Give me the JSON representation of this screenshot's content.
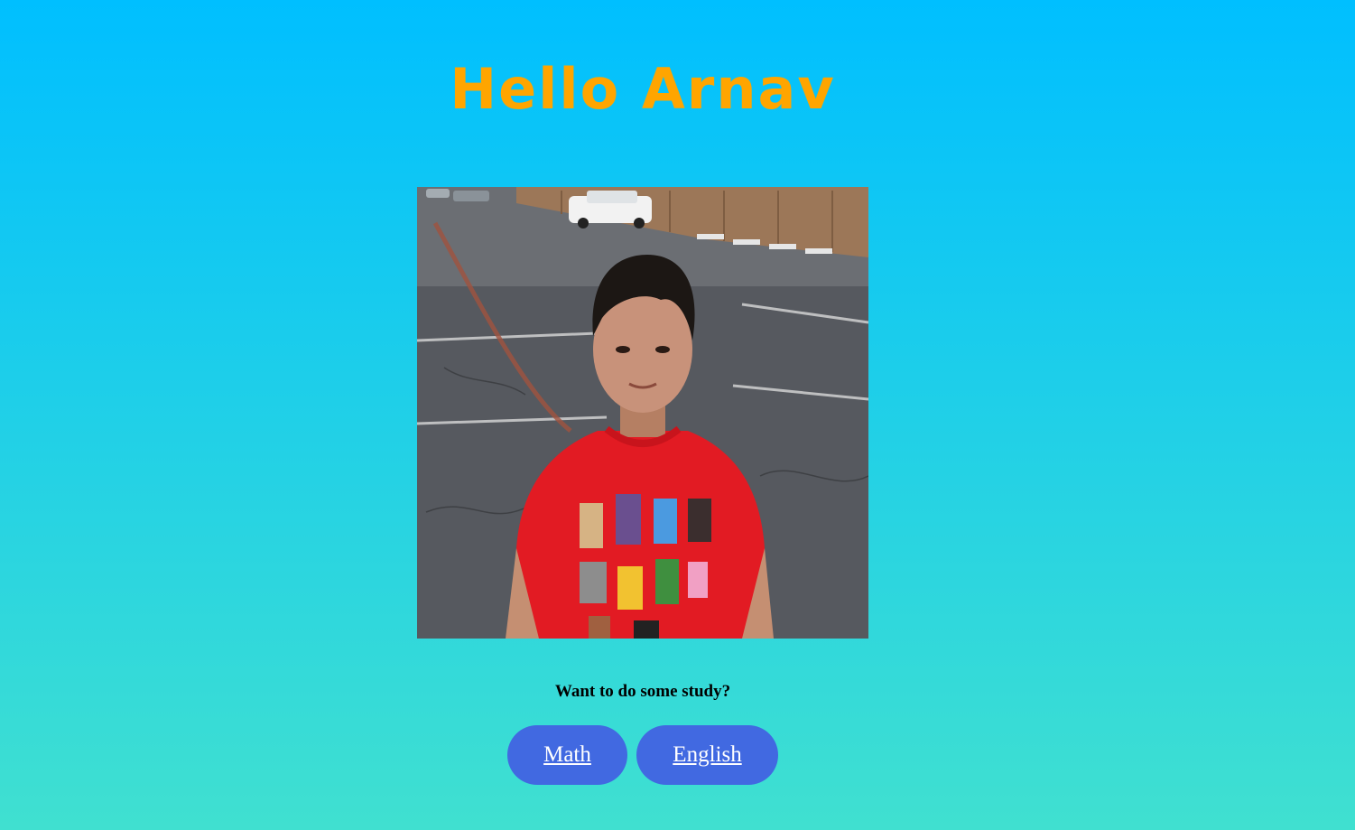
{
  "greeting": "Hello Arnav",
  "photo": {
    "description_icon": "child-photo"
  },
  "prompt": "Want to do some study?",
  "buttons": {
    "math_label": "Math",
    "english_label": "English"
  },
  "colors": {
    "background_top": "#00bfff",
    "background_bottom": "#40e0d0",
    "greeting": "#ffa500",
    "button": "#4169e1",
    "button_text": "#ffffff"
  }
}
